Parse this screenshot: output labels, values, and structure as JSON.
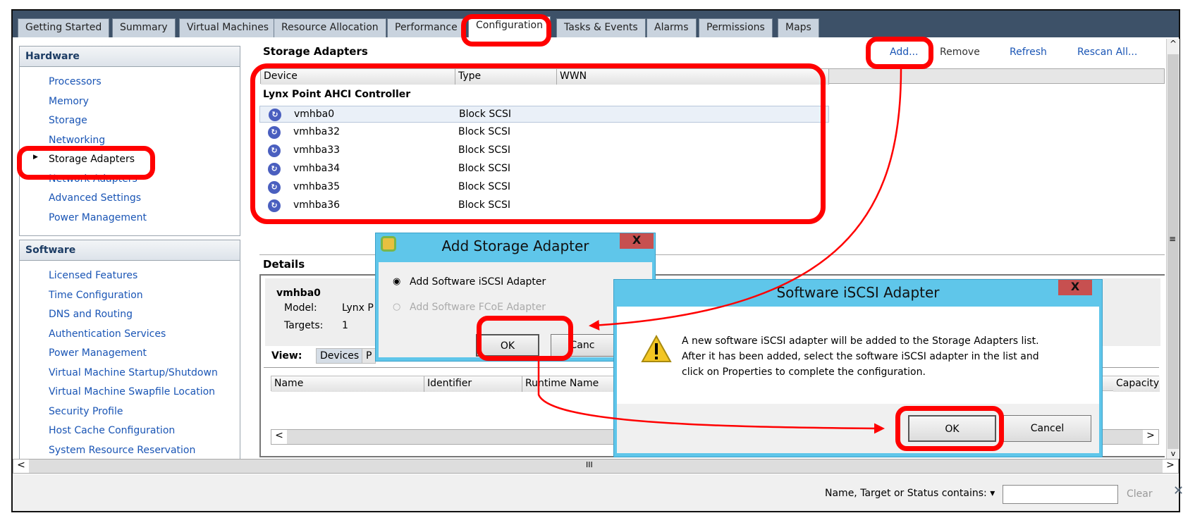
{
  "tabs": [
    "Getting Started",
    "Summary",
    "Virtual Machines",
    "Resource Allocation",
    "Performance",
    "Configuration",
    "Tasks & Events",
    "Alarms",
    "Permissions",
    "Maps"
  ],
  "active_tab": "Configuration",
  "sidebar": {
    "hardware_title": "Hardware",
    "hardware_items": [
      "Processors",
      "Memory",
      "Storage",
      "Networking",
      "Storage Adapters",
      "Network Adapters",
      "Advanced Settings",
      "Power Management"
    ],
    "selected_item": "Storage Adapters",
    "software_title": "Software",
    "software_items": [
      "Licensed Features",
      "Time Configuration",
      "DNS and Routing",
      "Authentication Services",
      "Power Management",
      "Virtual Machine Startup/Shutdown",
      "Virtual Machine Swapfile Location",
      "Security Profile",
      "Host Cache Configuration",
      "System Resource Reservation"
    ]
  },
  "main": {
    "title": "Storage Adapters",
    "actions": {
      "add": "Add...",
      "remove": "Remove",
      "refresh": "Refresh",
      "rescan": "Rescan All..."
    },
    "columns": [
      "Device",
      "Type",
      "WWN"
    ],
    "group": "Lynx Point AHCI Controller",
    "rows": [
      {
        "device": "vmhba0",
        "type": "Block SCSI"
      },
      {
        "device": "vmhba32",
        "type": "Block SCSI"
      },
      {
        "device": "vmhba33",
        "type": "Block SCSI"
      },
      {
        "device": "vmhba34",
        "type": "Block SCSI"
      },
      {
        "device": "vmhba35",
        "type": "Block SCSI"
      },
      {
        "device": "vmhba36",
        "type": "Block SCSI"
      }
    ]
  },
  "details": {
    "title": "Details",
    "name": "vmhba0",
    "model_label": "Model:",
    "model_value": "Lynx P",
    "targets_label": "Targets:",
    "targets_value": "1",
    "view_label": "View:",
    "view_devices": "Devices",
    "view_paths": "P",
    "columns": [
      "Name",
      "Identifier",
      "Runtime Name",
      "Capacity"
    ]
  },
  "dialog_add": {
    "title": "Add Storage Adapter",
    "opt1": "Add Software iSCSI Adapter",
    "opt2": "Add Software FCoE Adapter",
    "ok": "OK",
    "cancel": "Canc",
    "close": "X"
  },
  "dialog_iscsi": {
    "title": "Software iSCSI Adapter",
    "message_lines": [
      "A new software iSCSI adapter will be added to the Storage Adapters list.",
      "After it has been added, select the software iSCSI adapter in the list and",
      "click on Properties to complete the configuration."
    ],
    "ok": "OK",
    "cancel": "Cancel",
    "close": "X"
  },
  "filter": {
    "label": "Name, Target or Status contains: ▾",
    "value": "",
    "clear": "Clear",
    "close": "✕"
  },
  "scroll": {
    "grip": "III",
    "left": "<",
    "right": ">",
    "up": "^",
    "down": "v",
    "mid": "≡"
  },
  "colors": {
    "annotation": "#ff0000",
    "dialog_title": "#5fc6ea",
    "link": "#1a55b5"
  }
}
